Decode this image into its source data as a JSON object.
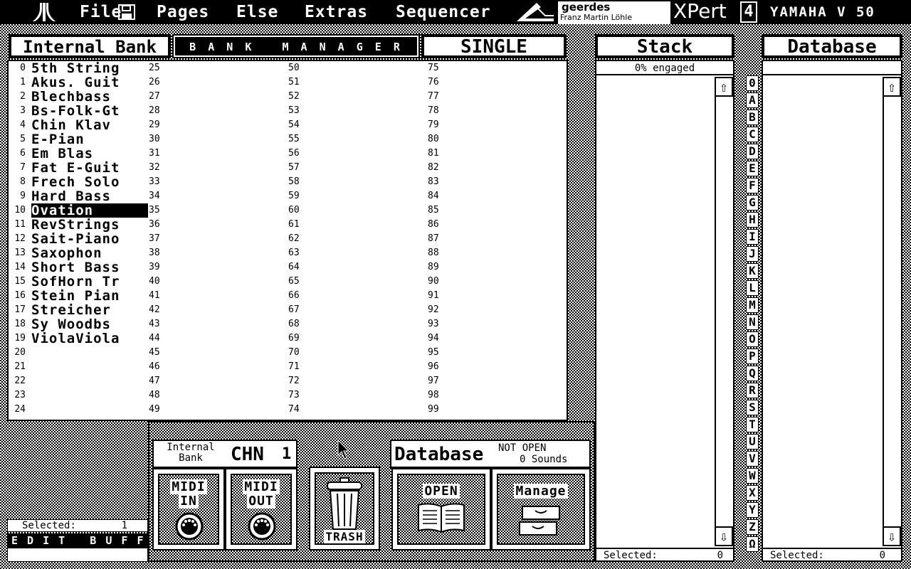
{
  "menubar": {
    "items": [
      "File",
      "Pages",
      "Else",
      "Extras",
      "Sequencer"
    ],
    "logo_text": "geerdes",
    "logo_subtext": "Franz Martin Löhle",
    "product": "XPert",
    "version_digit": "4",
    "device": "YAMAHA V 50"
  },
  "headers": {
    "internal_bank": "Internal Bank",
    "bank_manager": "B A N K   M A N A G E R",
    "single": "SINGLE",
    "stack": "Stack",
    "database": "Database"
  },
  "bank": {
    "names": [
      "5th String",
      "Akus. Guit",
      "Blechbass",
      "Bs-Folk-Gt",
      "Chin Klav",
      "E-Pian",
      "Em Blas",
      "Fat E-Guit",
      "Frech Solo",
      "Hard Bass",
      "Ovation",
      "RevStrings",
      "Sait-Piano",
      "Saxophon",
      "Short Bass",
      "SofHorn Tr",
      "Stein Pian",
      "Streicher",
      "Sy Woodbs",
      "ViolaViola"
    ],
    "selected_index": 10,
    "slot_count": 100
  },
  "stack": {
    "status": "0% engaged",
    "selected_label": "Selected:",
    "selected_count": "0"
  },
  "database_panel": {
    "selected_label": "Selected:",
    "selected_count": "0"
  },
  "index_letters": [
    "0",
    "A",
    "B",
    "C",
    "D",
    "E",
    "F",
    "G",
    "H",
    "I",
    "J",
    "K",
    "L",
    "M",
    "N",
    "O",
    "P",
    "Q",
    "R",
    "S",
    "T",
    "U",
    "V",
    "W",
    "X",
    "Y",
    "Z",
    "Ω"
  ],
  "left_bottom": {
    "selected_label": "Selected:",
    "selected_count": "1",
    "edit_buffer": "E D I T   B U F F E R"
  },
  "midi_panel": {
    "source_line1": "Internal",
    "source_line2": "Bank",
    "channel": "CHN",
    "channel_value": "1",
    "midi_in_line1": "MIDI",
    "midi_in_line2": "IN",
    "midi_out_line1": "MIDI",
    "midi_out_line2": "OUT"
  },
  "trash": {
    "label": "TRASH"
  },
  "db_panel": {
    "title": "Database",
    "status": "NOT OPEN",
    "sounds": "0 Sounds",
    "open_label": "OPEN",
    "manage_label": "Manage"
  },
  "icons": {
    "atari": "atari-logo-icon",
    "disk": "floppy-disk-icon",
    "scroll_up": "arrow-up-icon",
    "scroll_down": "arrow-down-icon",
    "midi": "midi-connector-icon",
    "trash": "trash-can-icon",
    "book": "open-book-icon",
    "drawer": "drawer-cabinet-icon",
    "cursor": "mouse-pointer-icon"
  }
}
